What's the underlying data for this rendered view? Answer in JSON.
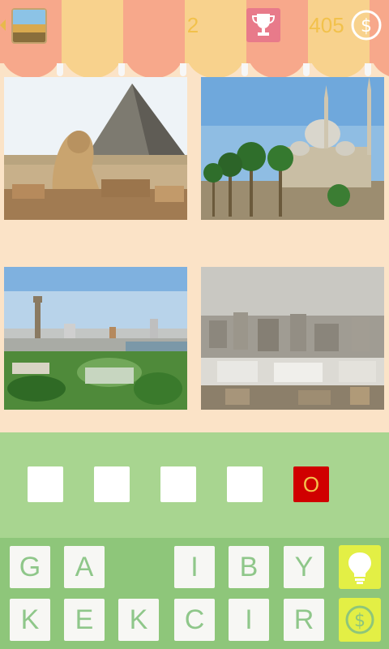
{
  "header": {
    "level": "2",
    "coins": "405",
    "back_icon": "back-arrow-icon",
    "thumbnail_icon": "level-thumbnail-icon",
    "trophy_icon": "trophy-icon",
    "coin_icon": "dollar-coin-icon"
  },
  "pictures": [
    {
      "subject": "pyramid-and-sphinx"
    },
    {
      "subject": "mosque-with-palms"
    },
    {
      "subject": "city-view-with-tower"
    },
    {
      "subject": "dense-cityscape"
    }
  ],
  "answer": {
    "slots": [
      "",
      "",
      "",
      "",
      "O"
    ],
    "filled_color": "#d00000"
  },
  "keyboard": {
    "rows": [
      [
        "G",
        "A",
        "",
        "I",
        "B",
        "Y"
      ],
      [
        "K",
        "E",
        "K",
        "C",
        "I",
        "R"
      ]
    ],
    "hint_icon": "lightbulb-icon",
    "buy_icon": "dollar-coin-icon",
    "letter_color": "#8fc78a"
  }
}
